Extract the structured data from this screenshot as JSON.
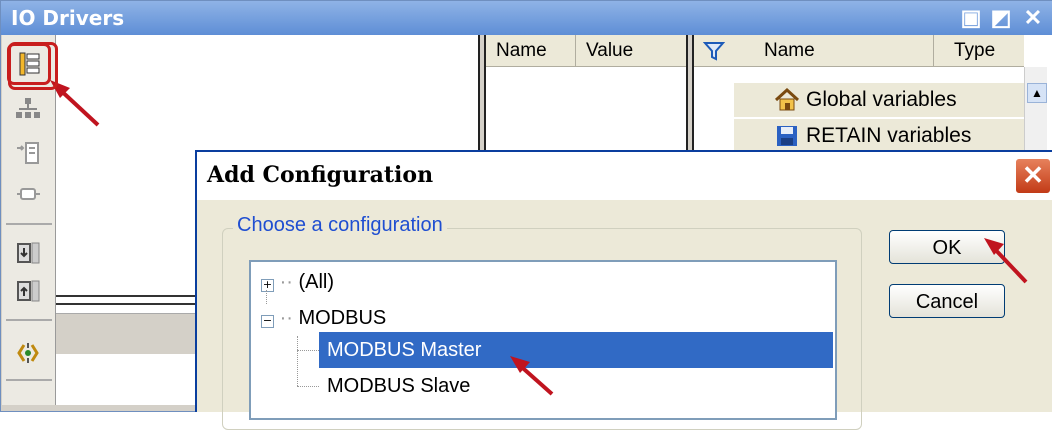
{
  "panel": {
    "title": "IO Drivers",
    "controls": [
      "window-icon",
      "pin-icon",
      "close-icon"
    ]
  },
  "properties_header": {
    "name": "Name",
    "value": "Value"
  },
  "variables": {
    "header_name": "Name",
    "header_type": "Type",
    "rows": [
      {
        "label": "Global variables",
        "icon": "house-icon"
      },
      {
        "label": "RETAIN variables",
        "icon": "floppy-icon"
      }
    ]
  },
  "dialog": {
    "title": "Add Configuration",
    "group_label": "Choose a configuration",
    "tree": {
      "all": "(All)",
      "modbus": "MODBUS",
      "master": "MODBUS Master",
      "slave": "MODBUS Slave"
    },
    "ok": "OK",
    "cancel": "Cancel"
  },
  "colors": {
    "title_bar": "#5e8ed6",
    "selection": "#316ac5",
    "annotation": "#c0141f"
  }
}
